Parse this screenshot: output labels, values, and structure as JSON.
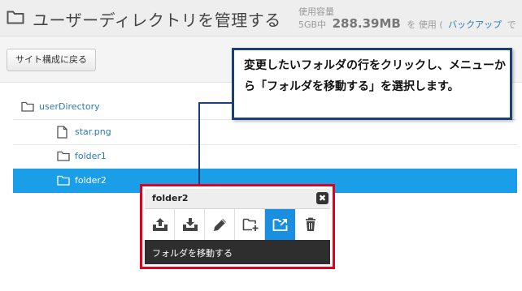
{
  "header": {
    "title": "ユーザーディレクトリを管理する",
    "usage_label": "使用容量",
    "usage_capacity": "5GB中",
    "usage_amount": "288.39MB",
    "usage_suffix": "を 使用 (",
    "backup_link": "バックアップ",
    "backup_suffix": "で"
  },
  "toolbar": {
    "back_label": "サイト構成に戻る"
  },
  "tree": {
    "rows": [
      {
        "label": "userDirectory",
        "icon": "folder-icon"
      },
      {
        "label": "star.png",
        "icon": "file-icon"
      },
      {
        "label": "folder1",
        "icon": "folder-icon"
      },
      {
        "label": "folder2",
        "icon": "folder-icon",
        "selected": true
      }
    ]
  },
  "callout": {
    "text": "変更したいフォルダの行をクリックし、メニューから「フォルダを移動する」を選択します。"
  },
  "context_menu": {
    "title": "folder2",
    "close_icon": "close-icon",
    "actions": [
      {
        "name": "upload",
        "icon": "upload-icon"
      },
      {
        "name": "download",
        "icon": "download-icon"
      },
      {
        "name": "rename",
        "icon": "pencil-icon"
      },
      {
        "name": "new-folder",
        "icon": "folder-add-icon"
      },
      {
        "name": "move-folder",
        "icon": "move-folder-icon",
        "active": true
      },
      {
        "name": "delete",
        "icon": "trash-icon"
      }
    ],
    "status": "フォルダを移動する"
  },
  "colors": {
    "selected_row": "#1a9ee8",
    "link": "#2a7ab8",
    "callout_border": "#1c3f7a",
    "highlight_border": "#e3001b",
    "status_bar": "#2e2e2e"
  }
}
